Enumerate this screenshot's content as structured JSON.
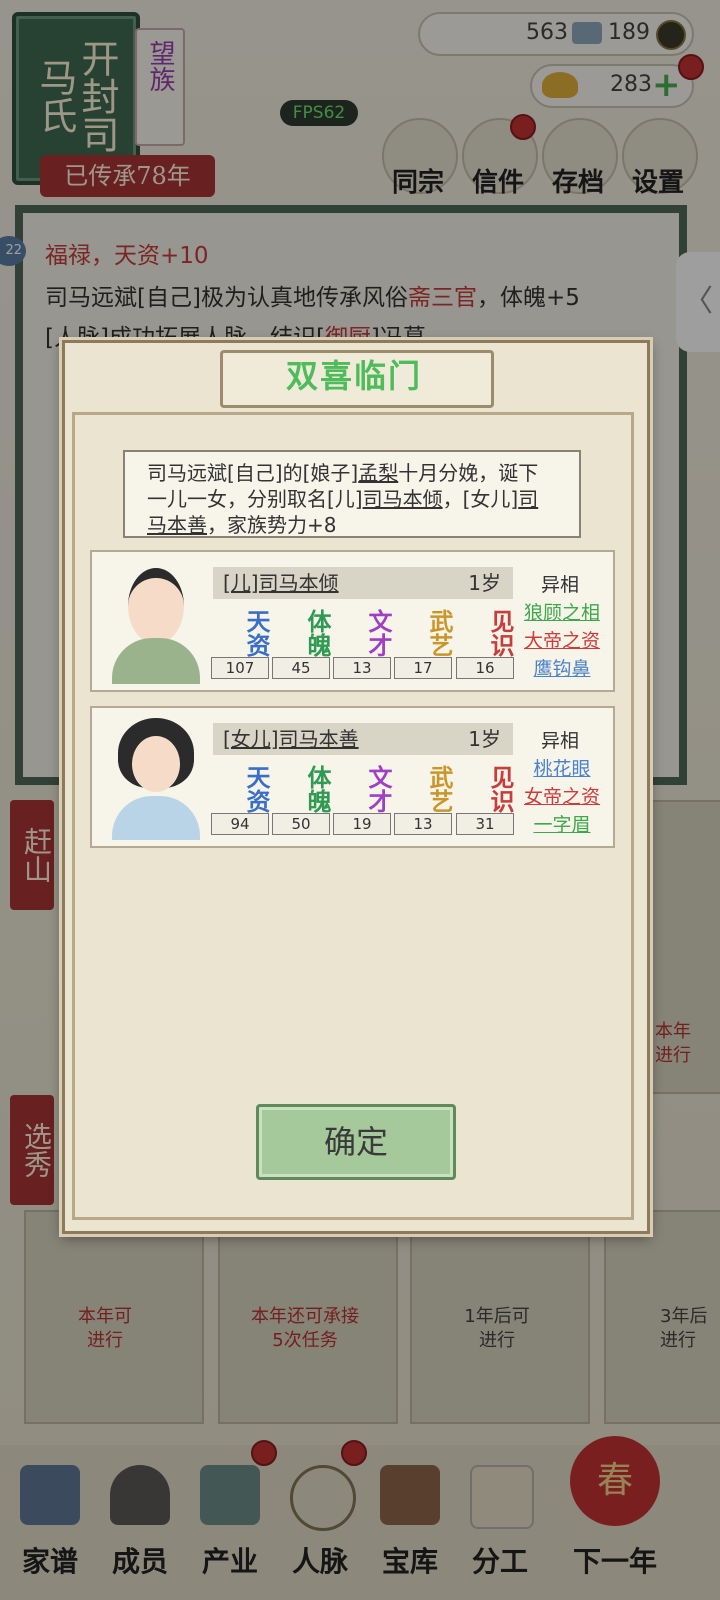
{
  "header": {
    "family_name": "开封司马氏",
    "family_title": "望族",
    "years_inherited": "已传承78年",
    "fps": "FPS62",
    "resources": {
      "silver": "563",
      "tickets": "189",
      "gold": "283"
    },
    "menu": [
      {
        "label": "同宗",
        "icon": "clan-book-icon"
      },
      {
        "label": "信件",
        "icon": "letter-icon"
      },
      {
        "label": "存档",
        "icon": "scroll-save-icon"
      },
      {
        "label": "设置",
        "icon": "gear-icon"
      }
    ],
    "badge_22": "22"
  },
  "log": {
    "line1": "福禄，天资+10",
    "line2_a": "司马远斌[自己]极为认真地传承风俗",
    "line2_b": "斋三官",
    "line2_c": "，体魄+5",
    "line3_a": "[人脉]成功拓展人脉，结识[",
    "line3_b": "御厨",
    "line3_c": "]冯葛"
  },
  "modal": {
    "title": "双喜临门",
    "desc_parts": [
      "司马远斌[自己]的[娘子]",
      "孟梨",
      "十月分娩，诞下一儿一女，分别取名[儿]",
      "司马本倾",
      "，[女儿]",
      "司马本善",
      "，家族势力+8"
    ],
    "attr_labels": [
      "天资",
      "体魄",
      "文才",
      "武艺",
      "见识"
    ],
    "traits_head": "异相",
    "children": [
      {
        "name": "[儿]司马本倾",
        "age": "1岁",
        "values": [
          "107",
          "45",
          "13",
          "17",
          "16"
        ],
        "traits": [
          {
            "text": "狼顾之相",
            "color": "#3ea84a"
          },
          {
            "text": "大帝之资",
            "color": "#d03a3a"
          },
          {
            "text": "鹰钩鼻",
            "color": "#4a83c9"
          }
        ]
      },
      {
        "name": "[女儿]司马本善",
        "age": "1岁",
        "values": [
          "94",
          "50",
          "19",
          "13",
          "31"
        ],
        "traits": [
          {
            "text": "桃花眼",
            "color": "#4a83c9"
          },
          {
            "text": "女帝之资",
            "color": "#d03a3a"
          },
          {
            "text": "一字眉",
            "color": "#3ea84a"
          }
        ]
      }
    ],
    "confirm": "确定"
  },
  "side_tabs": [
    "赶山",
    "选秀"
  ],
  "tasks": [
    {
      "text": "本年可\n进行"
    },
    {
      "text": "本年还可承接\n5次任务"
    },
    {
      "text": "1年后可\n进行"
    },
    {
      "text": "3年后\n进行"
    },
    {
      "text": "本年\n进行"
    }
  ],
  "nav": [
    {
      "label": "家谱"
    },
    {
      "label": "成员"
    },
    {
      "label": "产业"
    },
    {
      "label": "人脉"
    },
    {
      "label": "宝库"
    },
    {
      "label": "分工"
    },
    {
      "label": "下一年"
    }
  ],
  "next_year_badge": "春",
  "colors": {
    "accent_red": "#a83535",
    "title_green": "#4ebc5a",
    "frame_green": "#3f6a52"
  }
}
